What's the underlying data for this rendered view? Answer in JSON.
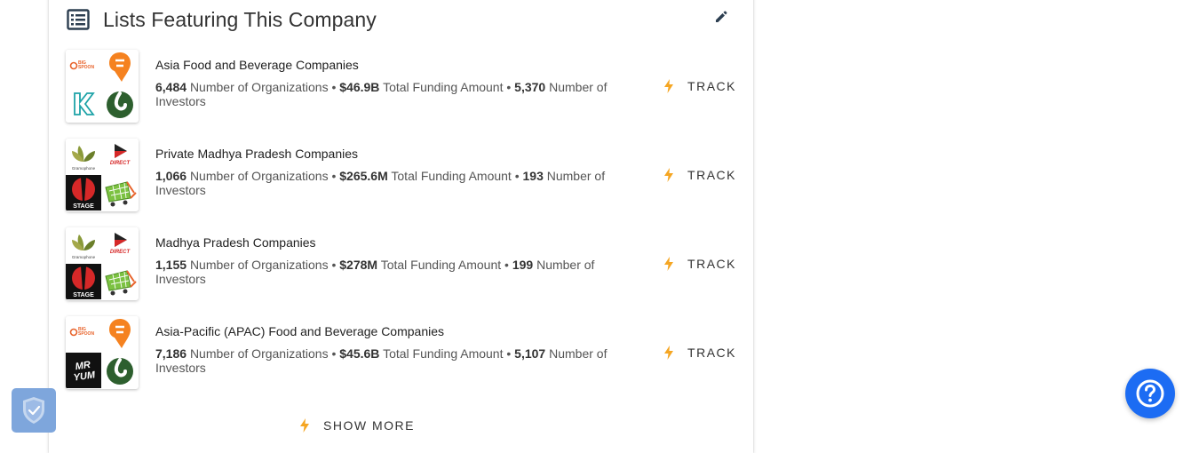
{
  "card": {
    "title": "Lists Featuring This Company",
    "header_icon": "list-icon",
    "edit_icon": "edit-pencil-icon"
  },
  "rows": [
    {
      "title": "Asia Food and Beverage Companies",
      "orgs": "6,484",
      "orgs_label": "Number of Organizations",
      "funding": "$46.9B",
      "funding_label": "Total Funding Amount",
      "investors": "5,370",
      "investors_label": "Number of Investors",
      "logos": [
        "big-spoon-logo",
        "swiggy-logo",
        "k-logo",
        "green-swirl-logo"
      ],
      "track_label": "TRACK"
    },
    {
      "title": "Private Madhya Pradesh Companies",
      "orgs": "1,066",
      "orgs_label": "Number of Organizations",
      "funding": "$265.6M",
      "funding_label": "Total Funding Amount",
      "investors": "193",
      "investors_label": "Number of Investors",
      "logos": [
        "gramophone-logo",
        "direct-logo",
        "stage-logo",
        "cart-logo"
      ],
      "track_label": "TRACK"
    },
    {
      "title": "Madhya Pradesh Companies",
      "orgs": "1,155",
      "orgs_label": "Number of Organizations",
      "funding": "$278M",
      "funding_label": "Total Funding Amount",
      "investors": "199",
      "investors_label": "Number of Investors",
      "logos": [
        "gramophone-logo",
        "direct-logo",
        "stage-logo",
        "cart-logo"
      ],
      "track_label": "TRACK"
    },
    {
      "title": "Asia-Pacific (APAC) Food and Beverage Companies",
      "orgs": "7,186",
      "orgs_label": "Number of Organizations",
      "funding": "$45.6B",
      "funding_label": "Total Funding Amount",
      "investors": "5,107",
      "investors_label": "Number of Investors",
      "logos": [
        "big-spoon-logo",
        "swiggy-logo",
        "mr-yum-logo",
        "green-swirl-logo"
      ],
      "track_label": "TRACK"
    }
  ],
  "show_more_label": "SHOW MORE",
  "logo_text": {
    "big_spoon_1": "BIG",
    "big_spoon_2": "SPOON",
    "gramophone": "Gramophone",
    "direct": "DIRECT",
    "stage": "STAGE",
    "mr_yum_1": "MR",
    "mr_yum_2": "YUM"
  },
  "colors": {
    "bolt": "#f5a623",
    "help_button": "#1c6cf3",
    "shield_badge": "#7ea6dc",
    "title_icon": "#2c3e50"
  },
  "floating": {
    "shield_icon": "shield-check-icon",
    "help_icon": "question-mark-icon"
  }
}
